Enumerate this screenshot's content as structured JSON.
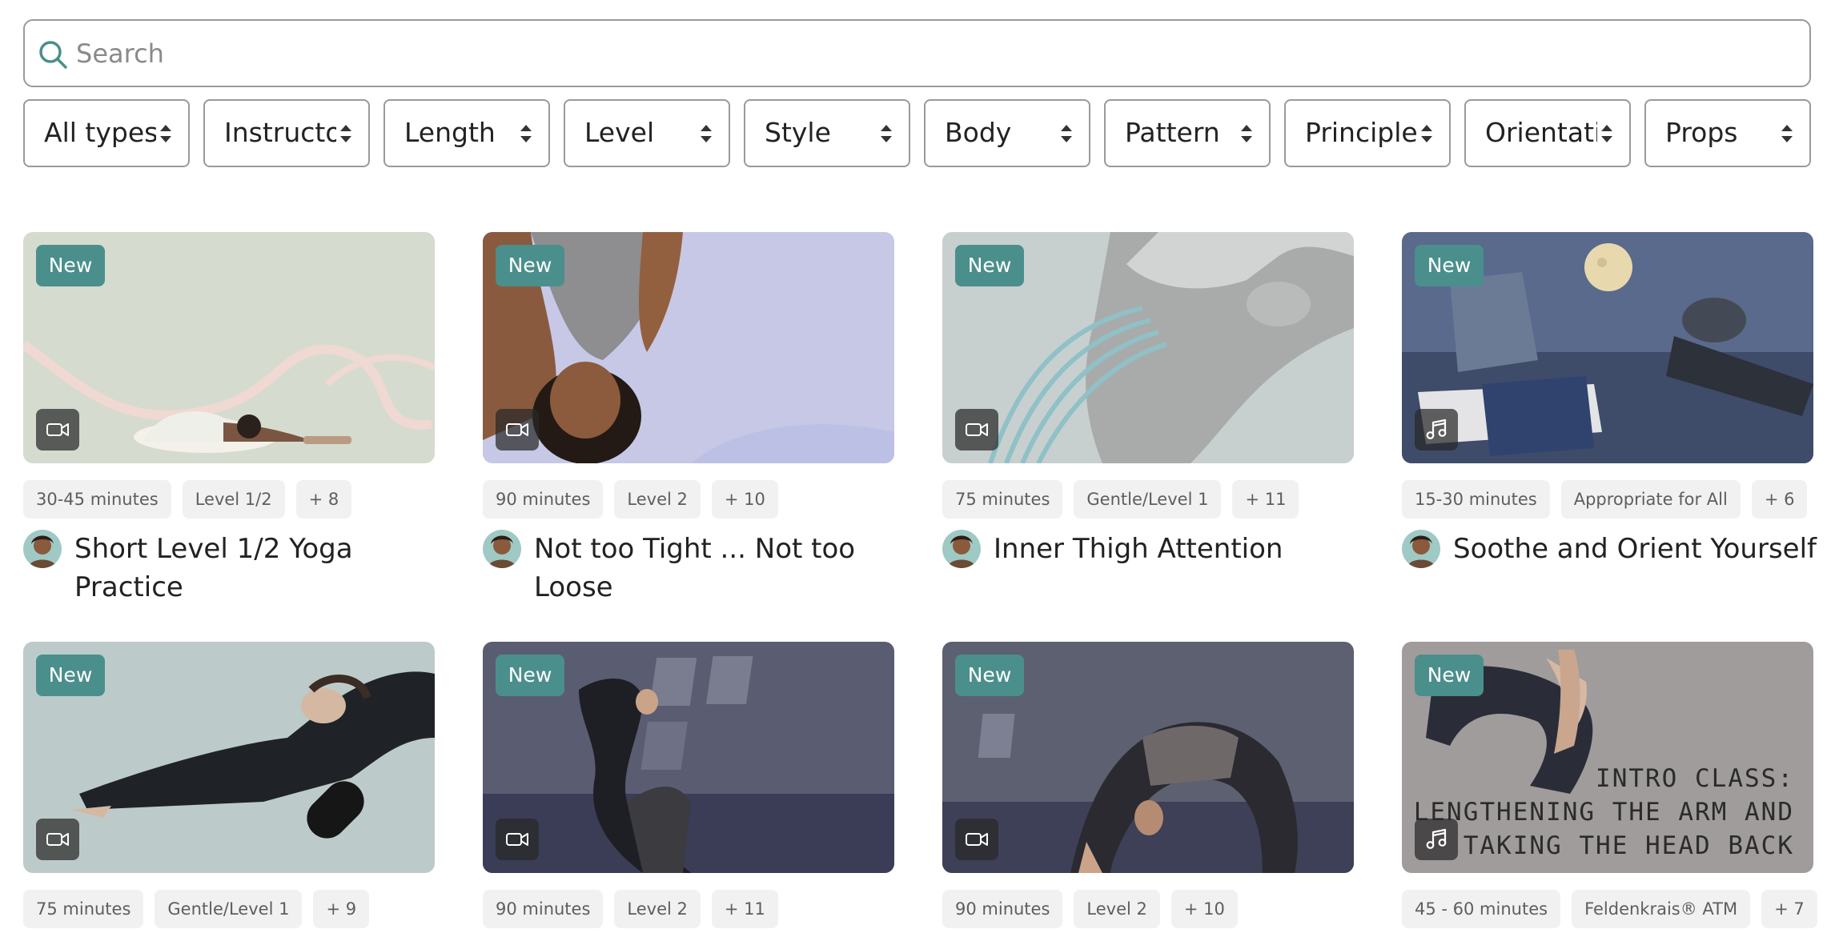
{
  "search": {
    "placeholder": "Search",
    "value": ""
  },
  "filters": [
    {
      "label": "All types"
    },
    {
      "label": "Instructor"
    },
    {
      "label": "Length"
    },
    {
      "label": "Level"
    },
    {
      "label": "Style"
    },
    {
      "label": "Body"
    },
    {
      "label": "Pattern"
    },
    {
      "label": "Principle"
    },
    {
      "label": "Orientation"
    },
    {
      "label": "Props"
    }
  ],
  "badge_text": "New",
  "cards": [
    {
      "title": "Short Level 1/2 Yoga Practice",
      "media": "video-icon",
      "tags": [
        "30-45 minutes",
        "Level 1/2",
        "+ 8"
      ]
    },
    {
      "title": "Not too Tight ... Not too Loose",
      "media": "video-icon",
      "tags": [
        "90 minutes",
        "Level 2",
        "+ 10"
      ]
    },
    {
      "title": "Inner Thigh Attention",
      "media": "video-icon",
      "tags": [
        "75 minutes",
        "Gentle/Level 1",
        "+ 11"
      ]
    },
    {
      "title": "Soothe and Orient Yourself",
      "media": "audio-icon",
      "tags": [
        "15-30 minutes",
        "Appropriate for All",
        "+ 6"
      ]
    },
    {
      "title": "",
      "media": "video-icon",
      "tags": [
        "75 minutes",
        "Gentle/Level 1",
        "+ 9"
      ]
    },
    {
      "title": "",
      "media": "video-icon",
      "tags": [
        "90 minutes",
        "Level 2",
        "+ 11"
      ]
    },
    {
      "title": "",
      "media": "video-icon",
      "tags": [
        "90 minutes",
        "Level 2",
        "+ 10"
      ]
    },
    {
      "title": "",
      "media": "audio-icon",
      "tags": [
        "45 - 60 minutes",
        "Feldenkrais® ATM",
        "+ 7"
      ],
      "overlay_text": [
        "INTRO CLASS:",
        "LENGTHENING THE ARM AND",
        "TAKING THE HEAD BACK"
      ]
    }
  ],
  "colors": {
    "accent": "#4a8f8c",
    "tag_bg": "#f1f1f1",
    "border": "#9a9a9a"
  }
}
